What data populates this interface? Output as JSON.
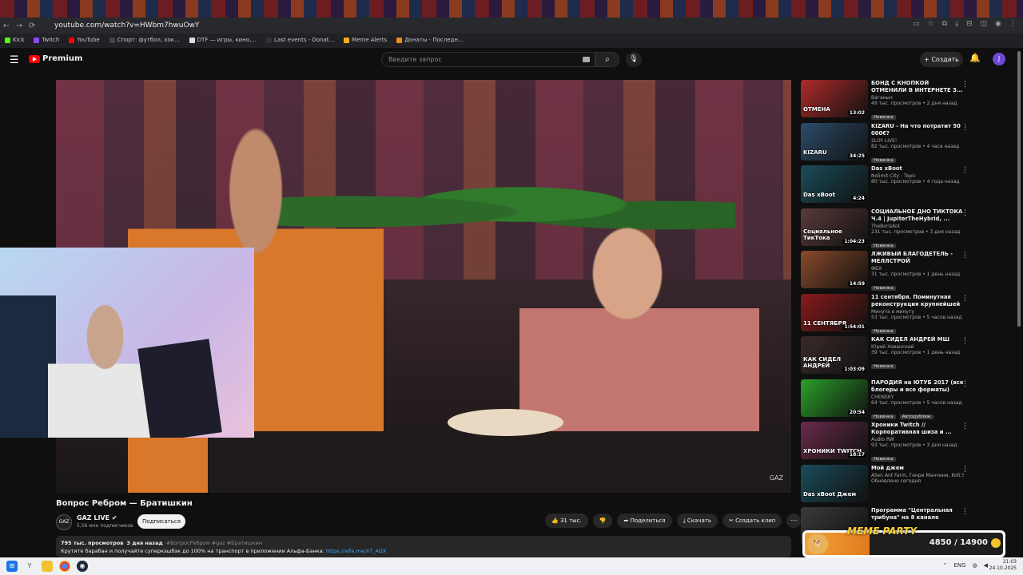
{
  "browser": {
    "url": "youtube.com/watch?v=HWbm7hwuOwY",
    "bookmarks": [
      {
        "label": "Kick",
        "color": "#53fc18"
      },
      {
        "label": "Twitch",
        "color": "#9146ff"
      },
      {
        "label": "YouTube",
        "color": "#ff0000"
      },
      {
        "label": "Спорт: футбол, хок...",
        "color": "#444444"
      },
      {
        "label": "DTF — игры, кино,...",
        "color": "#dddddd"
      },
      {
        "label": "Last events - Donat...",
        "color": "#333333"
      },
      {
        "label": "Meme Alerts",
        "color": "#f2b01e"
      },
      {
        "label": "Донаты - Последн...",
        "color": "#f28c1e"
      }
    ]
  },
  "header": {
    "logo_text": "Premium",
    "search_placeholder": "Введите запрос",
    "create_label": "Создать",
    "avatar_letter": "J"
  },
  "video": {
    "watermark": "GAZ",
    "title": "Вопрос Ребром — Братишкин",
    "channel_logo": "GAZ",
    "channel_name": "GAZ LIVE",
    "subscribers": "5,56 млн подписчиков",
    "subscribe_label": "Подписаться",
    "likes": "31 тыс.",
    "share_label": "Поделиться",
    "download_label": "Скачать",
    "clip_label": "Создать клип",
    "views": "795 тыс. просмотров",
    "date": "3 дня назад",
    "tags": "#ВопросРебром #gaz #Братишкин",
    "description": "Крутите барабан и получайте суперкэшбэк до 100% на транспорт в приложении Альфа-Банка: ",
    "link": "https://alfa.me/XT_AQX"
  },
  "sidebar": [
    {
      "title": "БОНД С КНОПКОЙ ОТМЕНИЛИ В ИНТЕРНЕТЕ З...",
      "channel": "Ваганыч",
      "meta": "49 тыс. просмотров • 2 дня назад",
      "duration": "13:02",
      "badge": "Новинка",
      "thumb_label": "ОТМЕНА",
      "color": "#b02a2a"
    },
    {
      "title": "KIZARU - На что потратит 50 000€?",
      "channel": "2LOY LIVE!",
      "meta": "82 тыс. просмотров • 4 часа назад",
      "duration": "34:25",
      "badge": "Новинка",
      "thumb_label": "KIZARU",
      "color": "#2c4d6b"
    },
    {
      "title": "Das xBoot",
      "channel": "Nolimit City - Topic",
      "meta": "80 тыс. просмотров • 4 года назад",
      "duration": "4:24",
      "badge": "",
      "thumb_label": "Das xBoot",
      "color": "#1a4d5a"
    },
    {
      "title": "СОЦИАЛЬНОЕ ДНО ТИКТОКА Ч.4 | JupiterTheHybrid, ...",
      "channel": "TheBorisKot",
      "meta": "231 тыс. просмотров • 3 дня назад",
      "duration": "1:04:23",
      "badge": "Новинка",
      "thumb_label": "Социальное ТикТока",
      "color": "#5a3a3a"
    },
    {
      "title": "ЛЖИВЫЙ БЛАГОДЕТЕЛЬ - МЕЛЛСТРОЙ",
      "channel": "ФБХ",
      "meta": "31 тыс. просмотров • 1 день назад",
      "duration": "14:59",
      "badge": "Новинка",
      "thumb_label": "",
      "color": "#8a4a2a"
    },
    {
      "title": "11 сентября. Поминутная реконструкция крупнейшей ...",
      "channel": "Минута в минуту",
      "meta": "53 тыс. просмотров • 5 часов назад",
      "duration": "1:54:01",
      "badge": "Новинка",
      "thumb_label": "11 СЕНТЯБРЯ",
      "color": "#8a1a1a"
    },
    {
      "title": "КАК СИДЕЛ АНДРЕЙ МШ",
      "channel": "Юрий Хованский",
      "meta": "39 тыс. просмотров • 1 день назад",
      "duration": "1:03:09",
      "badge": "Новинка",
      "thumb_label": "КАК СИДЕЛ АНДРЕЙ",
      "color": "#3a2a2a"
    },
    {
      "title": "ПАРОДИЯ на ЮТУБ 2017 (все блогеры и все форматы)",
      "channel": "CHENSKY",
      "meta": "64 тыс. просмотров • 5 часов назад",
      "duration": "20:54",
      "badge": "Новинка",
      "badge2": "Автодубляж",
      "thumb_label": "",
      "color": "#2aa02a"
    },
    {
      "title": "Хроники Twitch // Корпоративная шиза и ...",
      "channel": "Audio RW",
      "meta": "93 тыс. просмотров • 3 дня назад",
      "duration": "18:17",
      "badge": "Новинка",
      "thumb_label": "ХРОНИКИ TWITCH",
      "color": "#6a2a4a"
    },
    {
      "title": "Мой джем",
      "channel": "Alien Ant Farm, Генри Манчини, Kolt Se...",
      "meta": "Обновлено сегодня",
      "duration": "",
      "badge": "",
      "thumb_label": "Das xBoot Джем",
      "color": "#1a4d5a"
    },
    {
      "title": "Программа \"Центральная трибуна\" на 8 канале выпуск...",
      "channel": "",
      "meta": "",
      "duration": "",
      "badge": "",
      "thumb_label": "",
      "color": "#3a3a3a"
    }
  ],
  "overlay": {
    "title": "MEME PARTY",
    "count": "4850 / 14900",
    "progress": 0.3255
  },
  "taskbar": {
    "lang": "ENG",
    "time": "21:03",
    "date": "24.10.2025"
  }
}
